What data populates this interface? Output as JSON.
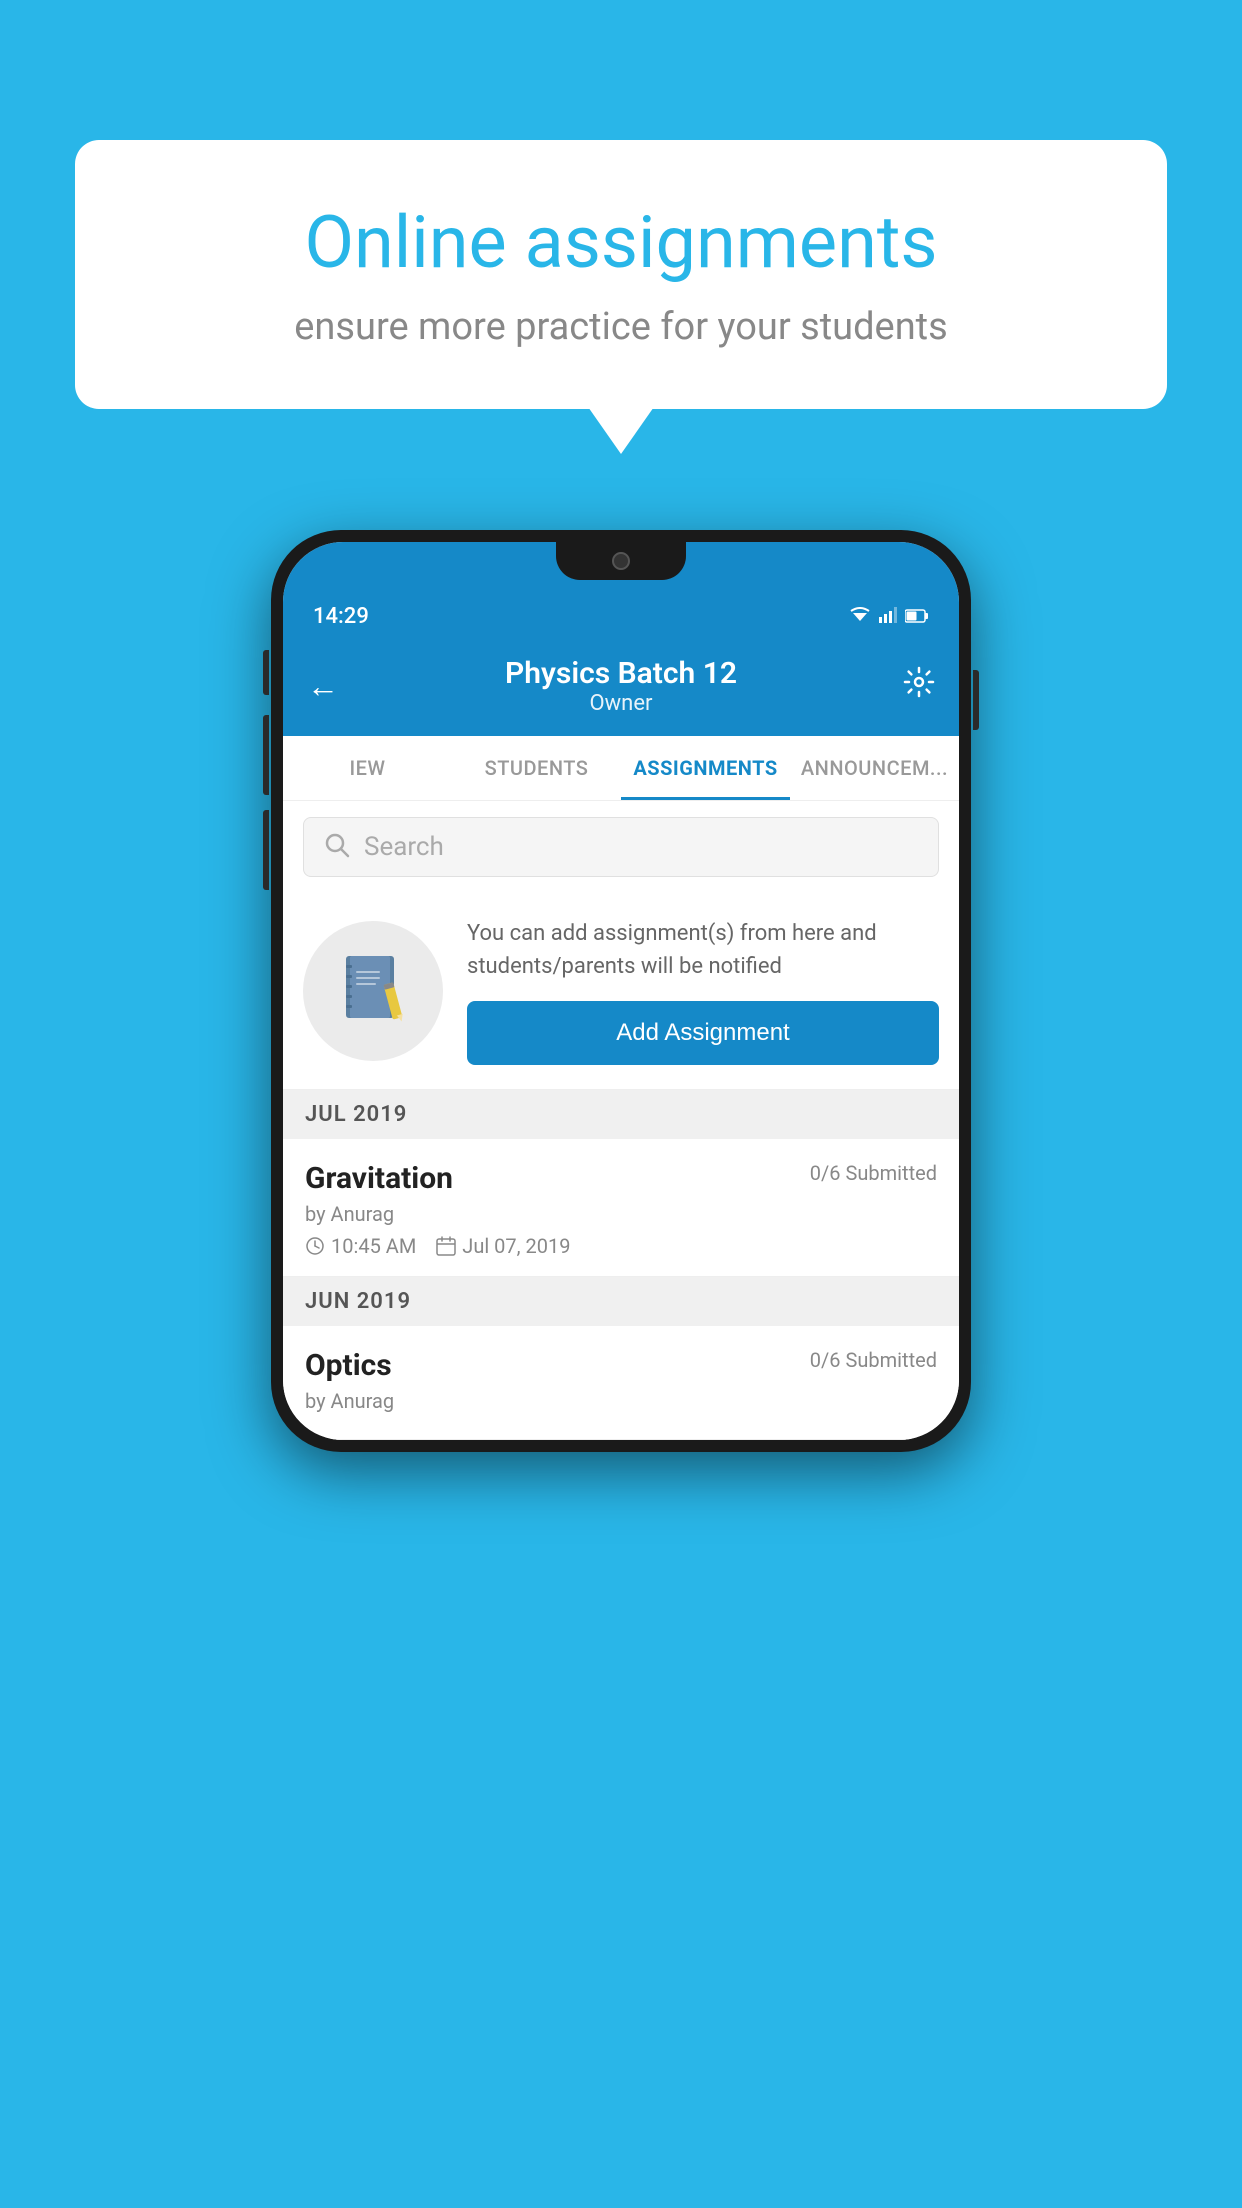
{
  "page": {
    "background_color": "#29b6e8"
  },
  "speech_bubble": {
    "title": "Online assignments",
    "subtitle": "ensure more practice for your students"
  },
  "status_bar": {
    "time": "14:29",
    "wifi_icon": "▼",
    "signal_icon": "◀",
    "battery_icon": "▮"
  },
  "app_header": {
    "back_label": "←",
    "title": "Physics Batch 12",
    "subtitle": "Owner",
    "settings_label": "⚙"
  },
  "tabs": [
    {
      "id": "iew",
      "label": "IEW",
      "active": false
    },
    {
      "id": "students",
      "label": "STUDENTS",
      "active": false
    },
    {
      "id": "assignments",
      "label": "ASSIGNMENTS",
      "active": true
    },
    {
      "id": "announcements",
      "label": "ANNOUNCEM...",
      "active": false
    }
  ],
  "search": {
    "placeholder": "Search"
  },
  "add_assignment_section": {
    "description": "You can add assignment(s) from here and students/parents will be notified",
    "button_label": "Add Assignment"
  },
  "months": [
    {
      "label": "JUL 2019",
      "assignments": [
        {
          "name": "Gravitation",
          "submitted": "0/6 Submitted",
          "by": "by Anurag",
          "time": "10:45 AM",
          "date": "Jul 07, 2019"
        }
      ]
    },
    {
      "label": "JUN 2019",
      "assignments": [
        {
          "name": "Optics",
          "submitted": "0/6 Submitted",
          "by": "by Anurag",
          "time": "",
          "date": ""
        }
      ]
    }
  ],
  "colors": {
    "primary": "#1589c8",
    "background_light": "#f0f0f0",
    "text_dark": "#222222",
    "text_light": "#888888"
  }
}
